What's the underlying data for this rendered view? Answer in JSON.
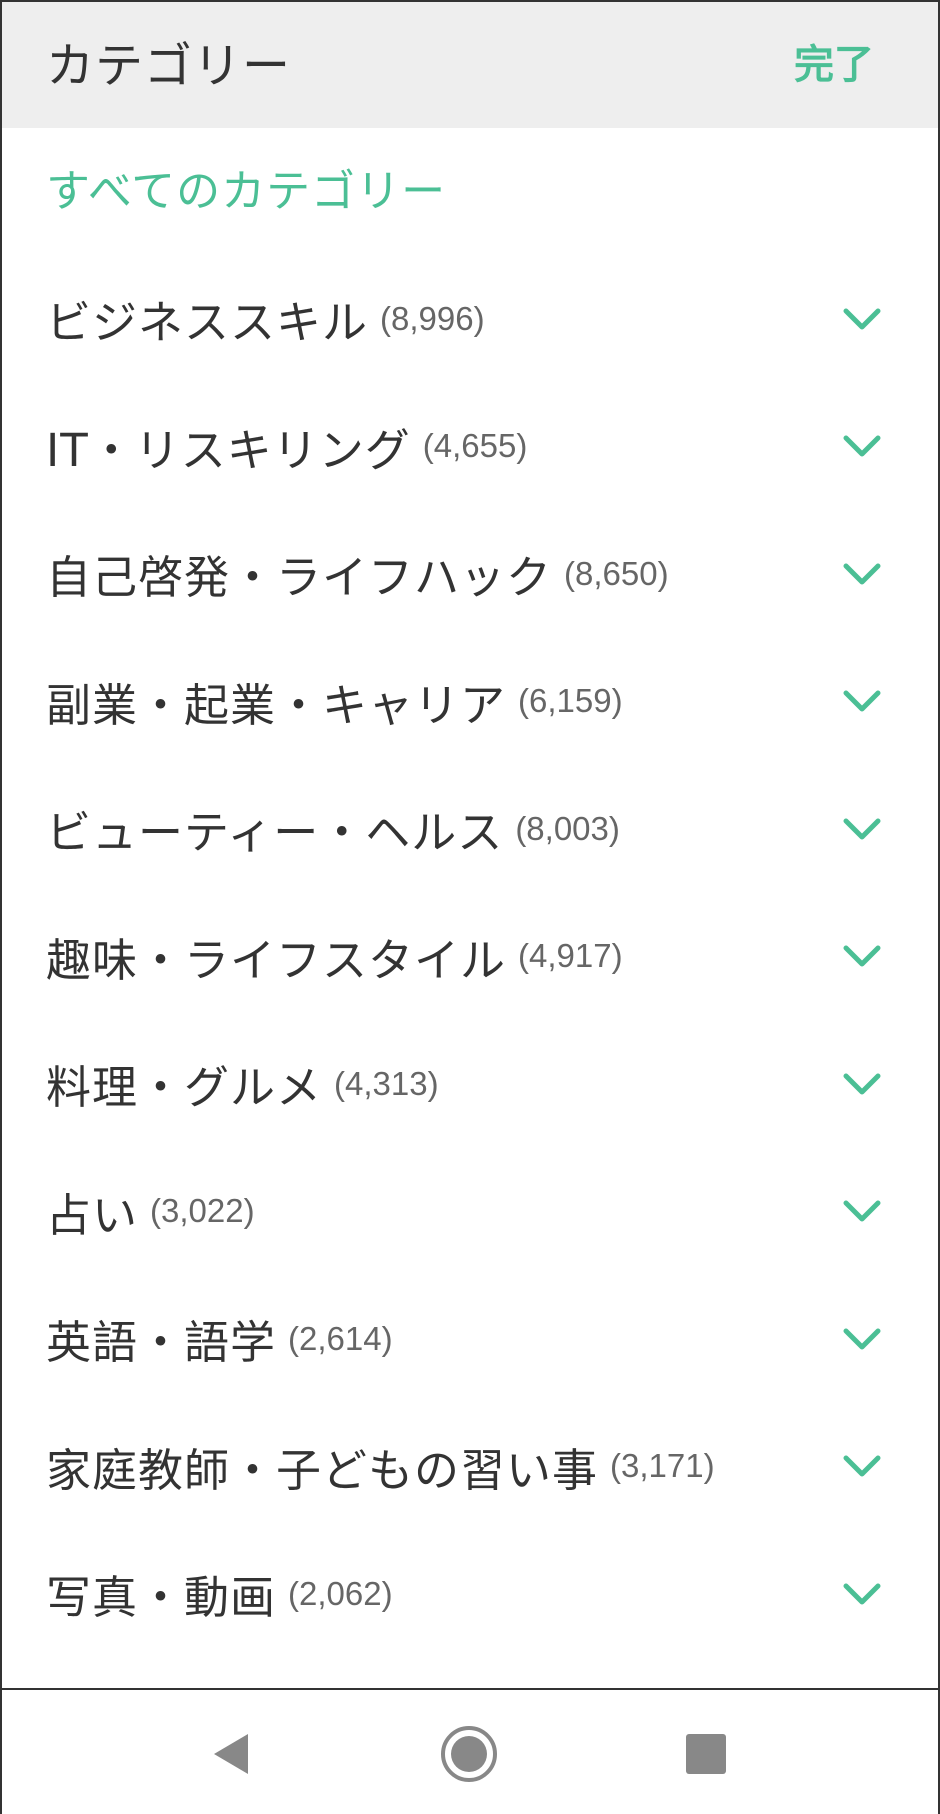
{
  "header": {
    "title": "カテゴリー",
    "done_label": "完了"
  },
  "all_categories_label": "すべてのカテゴリー",
  "categories": [
    {
      "name": "ビジネススキル",
      "count": "(8,996)"
    },
    {
      "name": "IT・リスキリング",
      "count": "(4,655)"
    },
    {
      "name": "自己啓発・ライフハック",
      "count": "(8,650)"
    },
    {
      "name": "副業・起業・キャリア",
      "count": "(6,159)"
    },
    {
      "name": "ビューティー・ヘルス",
      "count": "(8,003)"
    },
    {
      "name": "趣味・ライフスタイル",
      "count": "(4,917)"
    },
    {
      "name": "料理・グルメ",
      "count": "(4,313)"
    },
    {
      "name": "占い",
      "count": "(3,022)"
    },
    {
      "name": "英語・語学",
      "count": "(2,614)"
    },
    {
      "name": "家庭教師・子どもの習い事",
      "count": "(3,171)"
    },
    {
      "name": "写真・動画",
      "count": "(2,062)"
    }
  ],
  "colors": {
    "accent": "#4bbf95",
    "text": "#333333",
    "count": "#666666",
    "header_bg": "#eeeeee",
    "nav_icon": "#888888"
  },
  "icons": {
    "expand": "chevron-down-icon",
    "nav_back": "back-triangle-icon",
    "nav_home": "home-circle-icon",
    "nav_recents": "recents-square-icon"
  }
}
